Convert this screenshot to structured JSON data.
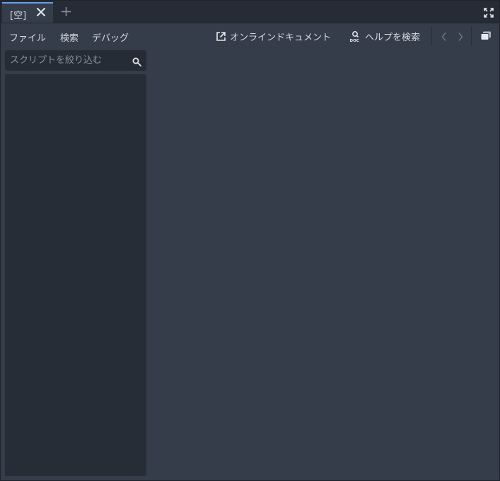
{
  "tabs": [
    {
      "label": "[空]"
    }
  ],
  "menu": {
    "file": "ファイル",
    "search": "検索",
    "debug": "デバッグ"
  },
  "toolbar": {
    "online_docs": "オンラインドキュメント",
    "search_help": "ヘルプを検索"
  },
  "script_filter": {
    "placeholder": "スクリプトを絞り込む",
    "value": ""
  },
  "icons": {
    "close": "close-icon",
    "add": "plus-icon",
    "fullscreen": "expand-icon",
    "external_link": "external-link-icon",
    "help_search": "doc-search-icon",
    "back": "chevron-left-icon",
    "forward": "chevron-right-icon",
    "toggle_panel": "panel-toggle-icon",
    "search": "search-icon"
  },
  "colors": {
    "background": "#363d4a",
    "panel": "#272d36",
    "tabbar": "#262c36",
    "accent": "#6f9dd9",
    "text": "#d6dae1"
  }
}
